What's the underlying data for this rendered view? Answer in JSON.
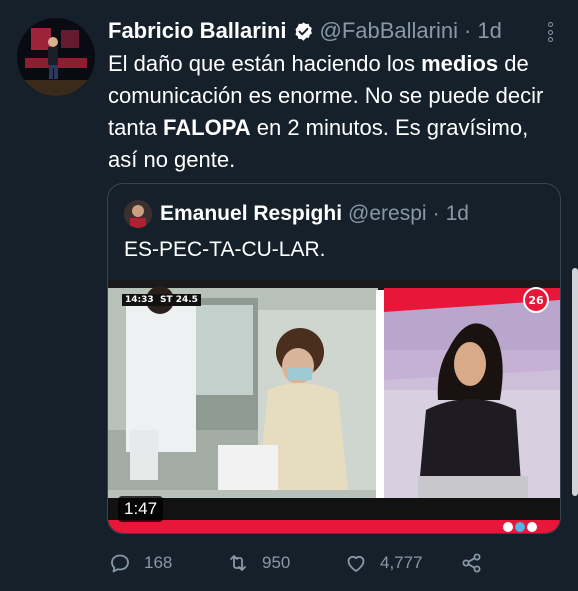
{
  "tweet": {
    "author_name": "Fabricio Ballarini",
    "author_handle": "@FabBallarini",
    "separator": "·",
    "time": "1d",
    "text_parts": [
      "El daño que están haciendo los ",
      "medios",
      " de comunicación es enorme. No se puede decir tanta ",
      "FALOPA",
      " en 2 minutos. Es gravísimo, así no gente."
    ],
    "verified": true
  },
  "quote": {
    "author_name": "Emanuel Respighi",
    "author_handle": "@erespi",
    "separator": "·",
    "time": "1d",
    "text": "ES-PEC-TA-CU-LAR.",
    "video": {
      "duration": "1:47",
      "overlay_time": "14:33",
      "overlay_temp": "ST 24.5",
      "channel_logo": "26"
    }
  },
  "actions": {
    "reply_count": "168",
    "retweet_count": "950",
    "like_count": "4,777"
  },
  "colors": {
    "background": "#15202b",
    "secondary_text": "#8899a6",
    "border": "#38444d",
    "channel_red": "#e8173a"
  },
  "icons": [
    "verified-badge-icon",
    "more-options-icon",
    "reply-icon",
    "retweet-icon",
    "like-icon",
    "share-icon"
  ]
}
